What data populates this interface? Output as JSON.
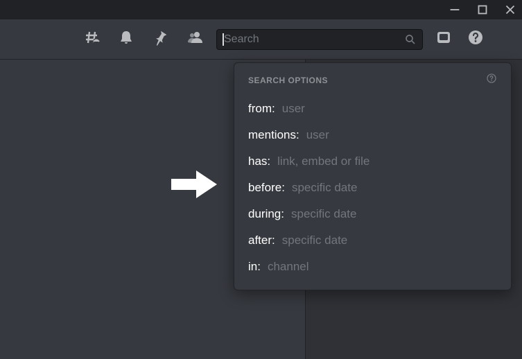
{
  "window": {
    "minimize": "minimize",
    "maximize": "maximize",
    "close": "close"
  },
  "search": {
    "placeholder": "Search"
  },
  "popover": {
    "title": "SEARCH OPTIONS",
    "options": [
      {
        "key": "from:",
        "hint": "user"
      },
      {
        "key": "mentions:",
        "hint": "user"
      },
      {
        "key": "has:",
        "hint": "link, embed or file"
      },
      {
        "key": "before:",
        "hint": "specific date"
      },
      {
        "key": "during:",
        "hint": "specific date"
      },
      {
        "key": "after:",
        "hint": "specific date"
      },
      {
        "key": "in:",
        "hint": "channel"
      }
    ]
  }
}
